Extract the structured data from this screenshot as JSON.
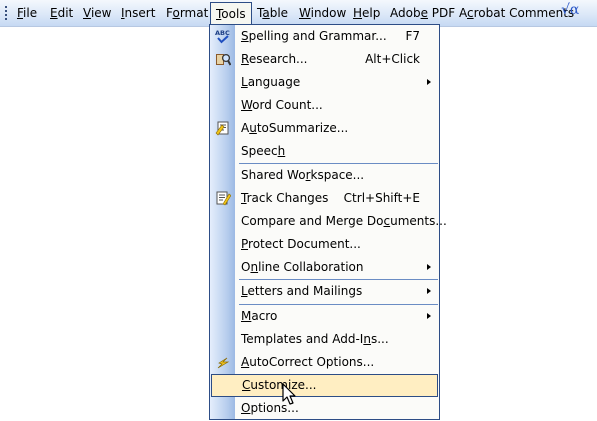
{
  "menubar": {
    "items": [
      {
        "label": "File",
        "underline": 0
      },
      {
        "label": "Edit",
        "underline": 0
      },
      {
        "label": "View",
        "underline": 0
      },
      {
        "label": "Insert",
        "underline": 0
      },
      {
        "label": "Format",
        "underline": 1
      },
      {
        "label": "Tools",
        "underline": 0
      },
      {
        "label": "Table",
        "underline": 1
      },
      {
        "label": "Window",
        "underline": 0
      },
      {
        "label": "Help",
        "underline": 0
      },
      {
        "label": "Adobe PDF",
        "underline": 4
      },
      {
        "label": "Acrobat Comments",
        "underline": 1
      }
    ],
    "active": "Tools",
    "trailing_symbol": "√α"
  },
  "tools_menu": {
    "items": [
      {
        "label": "Spelling and Grammar...",
        "underline": 0,
        "shortcut": "F7",
        "icon": "spelling-abc-check-icon"
      },
      {
        "label": "Research...",
        "underline": 0,
        "shortcut": "Alt+Click",
        "icon": "research-book-magnifier-icon"
      },
      {
        "label": "Language",
        "underline": 0,
        "submenu": true
      },
      {
        "label": "Word Count...",
        "underline": 0
      },
      {
        "label": "AutoSummarize...",
        "underline": 1,
        "icon": "autosummarize-icon"
      },
      {
        "label": "Speech",
        "underline": 5
      },
      {
        "separator": true
      },
      {
        "label": "Shared Workspace...",
        "underline": 9
      },
      {
        "label": "Track Changes",
        "underline": 0,
        "shortcut": "Ctrl+Shift+E",
        "icon": "track-changes-icon"
      },
      {
        "label": "Compare and Merge Documents...",
        "underline": 20
      },
      {
        "label": "Protect Document...",
        "underline": 0
      },
      {
        "label": "Online Collaboration",
        "underline": 1,
        "submenu": true
      },
      {
        "separator": true
      },
      {
        "label": "Letters and Mailings",
        "underline": 0,
        "submenu": true
      },
      {
        "separator": true
      },
      {
        "label": "Macro",
        "underline": 0,
        "submenu": true
      },
      {
        "label": "Templates and Add-Ins...",
        "underline": 19
      },
      {
        "label": "AutoCorrect Options...",
        "underline": 0,
        "icon": "autocorrect-lightning-icon"
      },
      {
        "label": "Customize...",
        "underline": 0,
        "highlighted": true
      },
      {
        "label": "Options...",
        "underline": 0
      }
    ]
  },
  "colors": {
    "menu_border": "#2d4d86",
    "highlight": "#ffeec2",
    "separator": "#6a8cc4",
    "icon_strip": "#b9cfee"
  }
}
